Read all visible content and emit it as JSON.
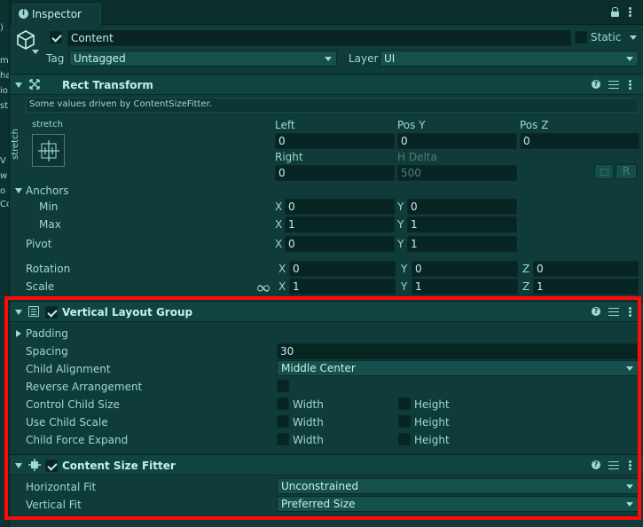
{
  "left_strip": {
    "chars": [
      ")",
      "m",
      "ha",
      "io",
      "st",
      "V",
      "w",
      "o",
      "Co"
    ]
  },
  "window": {
    "tab_label": "Inspector",
    "tab_icon": "info-icon"
  },
  "gameobject": {
    "name": "Content",
    "active": true,
    "static_label": "Static",
    "static": false,
    "tag_label": "Tag",
    "tag_value": "Untagged",
    "layer_label": "Layer",
    "layer_value": "UI"
  },
  "rect_transform": {
    "title": "Rect Transform",
    "notice": "Some values driven by ContentSizeFitter.",
    "anchor_preset_top": "stretch",
    "anchor_preset_side": "stretch",
    "col1_label": "Left",
    "col2_label": "Pos Y",
    "col3_label": "Pos Z",
    "left": "0",
    "pos_y": "0",
    "pos_z": "0",
    "right_label": "Right",
    "hdelta_label": "H Delta",
    "right": "0",
    "h_delta": "500",
    "r_button": "R",
    "anchors_label": "Anchors",
    "min_label": "Min",
    "max_label": "Max",
    "min_x": "0",
    "min_y": "0",
    "max_x": "1",
    "max_y": "1",
    "pivot_label": "Pivot",
    "pivot_x": "0",
    "pivot_y": "1",
    "rotation_label": "Rotation",
    "rot_x": "0",
    "rot_y": "0",
    "rot_z": "0",
    "scale_label": "Scale",
    "scale_x": "1",
    "scale_y": "1",
    "scale_z": "1",
    "x": "X",
    "y": "Y",
    "z": "Z"
  },
  "vertical_layout_group": {
    "title": "Vertical Layout Group",
    "enabled": true,
    "padding_label": "Padding",
    "spacing_label": "Spacing",
    "spacing_value": "30",
    "child_alignment_label": "Child Alignment",
    "child_alignment_value": "Middle Center",
    "reverse_label": "Reverse Arrangement",
    "reverse_value": false,
    "control_child_size_label": "Control Child Size",
    "use_child_scale_label": "Use Child Scale",
    "child_force_expand_label": "Child Force Expand",
    "width_label": "Width",
    "height_label": "Height",
    "control_width": false,
    "control_height": false,
    "scale_width": false,
    "scale_height": false,
    "expand_width": false,
    "expand_height": false
  },
  "content_size_fitter": {
    "title": "Content Size Fitter",
    "enabled": true,
    "horizontal_fit_label": "Horizontal Fit",
    "horizontal_fit_value": "Unconstrained",
    "vertical_fit_label": "Vertical Fit",
    "vertical_fit_value": "Preferred Size"
  },
  "colors": {
    "highlight_box": "#ff0a0a",
    "background": "#0f3b3a",
    "text": "#9fd8cf"
  }
}
